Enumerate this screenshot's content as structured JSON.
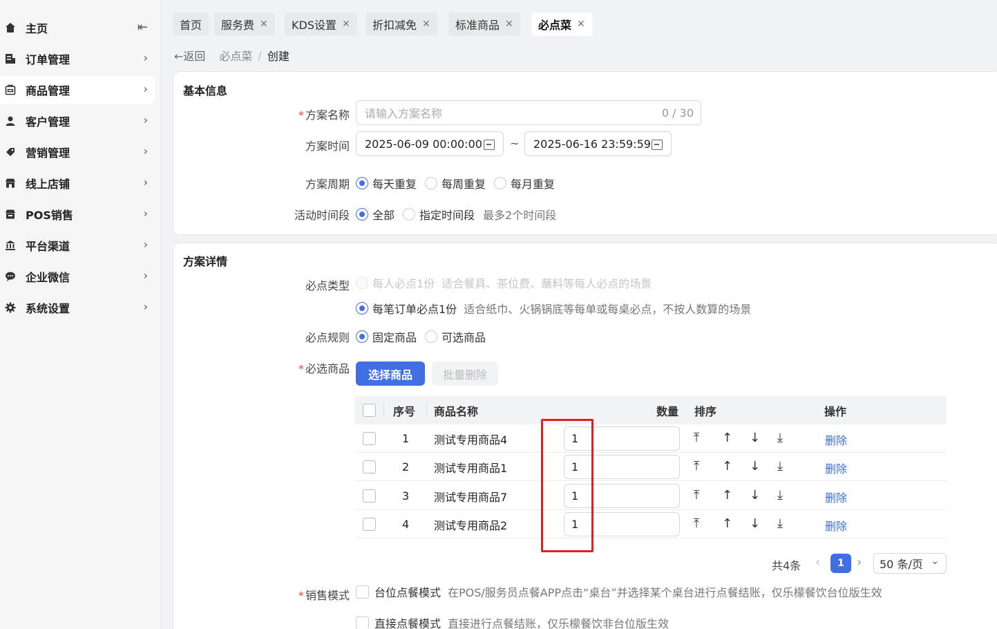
{
  "sidebar": {
    "items": [
      {
        "label": "主页",
        "icon": "home-icon"
      },
      {
        "label": "订单管理",
        "icon": "order-icon"
      },
      {
        "label": "商品管理",
        "icon": "goods-icon"
      },
      {
        "label": "客户管理",
        "icon": "user-icon"
      },
      {
        "label": "营销管理",
        "icon": "tag-icon"
      },
      {
        "label": "线上店铺",
        "icon": "store-icon"
      },
      {
        "label": "POS销售",
        "icon": "pos-icon"
      },
      {
        "label": "平台渠道",
        "icon": "bank-icon"
      },
      {
        "label": "企业微信",
        "icon": "chat-icon"
      },
      {
        "label": "系统设置",
        "icon": "gear-icon"
      }
    ],
    "active": "商品管理"
  },
  "tabs": [
    "首页",
    "服务费",
    "KDS设置",
    "折扣减免",
    "标准商品",
    "必点菜"
  ],
  "active_tab": "必点菜",
  "breadcrumb": {
    "back": "返回",
    "parent": "必点菜",
    "sep": "/",
    "current": "创建"
  },
  "basic": {
    "title": "基本信息",
    "name_label": "方案名称",
    "name_placeholder": "请输入方案名称",
    "name_counter": "0 / 30",
    "time_label": "方案时间",
    "start_time": "2025-06-09 00:00:00",
    "range_sep": "~",
    "end_time": "2025-06-16 23:59:59",
    "cycle_label": "方案周期",
    "cycle_options": [
      "每天重复",
      "每周重复",
      "每月重复"
    ],
    "cycle_selected": 0,
    "period_label": "活动时间段",
    "period_options": [
      "全部",
      "指定时间段"
    ],
    "period_selected": 0,
    "period_hint": "最多2个时间段"
  },
  "detail": {
    "title": "方案详情",
    "type_label": "必点类型",
    "type_options": [
      {
        "label": "每人必点1份",
        "hint": "适合餐具、茶位费、蘸料等每人必点的场景",
        "disabled": true
      },
      {
        "label": "每笔订单必点1份",
        "hint": "适合纸巾、火锅锅底等每单或每桌必点，不按人数算的场景",
        "disabled": false
      }
    ],
    "rule_label": "必点规则",
    "rule_options": [
      "固定商品",
      "可选商品"
    ],
    "required_label": "必选商品",
    "select_button": "选择商品",
    "batch_delete": "批量删除",
    "table": {
      "headers": {
        "index": "序号",
        "name": "商品名称",
        "qty": "数量",
        "sort": "排序",
        "action": "操作"
      },
      "rows": [
        {
          "index": "1",
          "name": "测试专用商品4",
          "qty": "1",
          "action": "删除"
        },
        {
          "index": "2",
          "name": "测试专用商品1",
          "qty": "1",
          "action": "删除"
        },
        {
          "index": "3",
          "name": "测试专用商品7",
          "qty": "1",
          "action": "删除"
        },
        {
          "index": "4",
          "name": "测试专用商品2",
          "qty": "1",
          "action": "删除"
        }
      ]
    },
    "pagination": {
      "total": "共4条",
      "page": "1",
      "page_size": "50 条/页"
    },
    "sale_label": "销售模式",
    "sale_options": [
      {
        "label": "台位点餐模式",
        "hint": "在POS/服务员点餐APP点击“桌台”并选择某个桌台进行点餐结账，仅乐檬餐饮台位版生效"
      },
      {
        "label": "直接点餐模式",
        "hint": "直接进行点餐结账，仅乐檬餐饮非台位版生效"
      }
    ]
  },
  "colors": {
    "primary": "#3f6fe3",
    "required_star": "#e3473c",
    "highlight_box": "#e02020"
  }
}
